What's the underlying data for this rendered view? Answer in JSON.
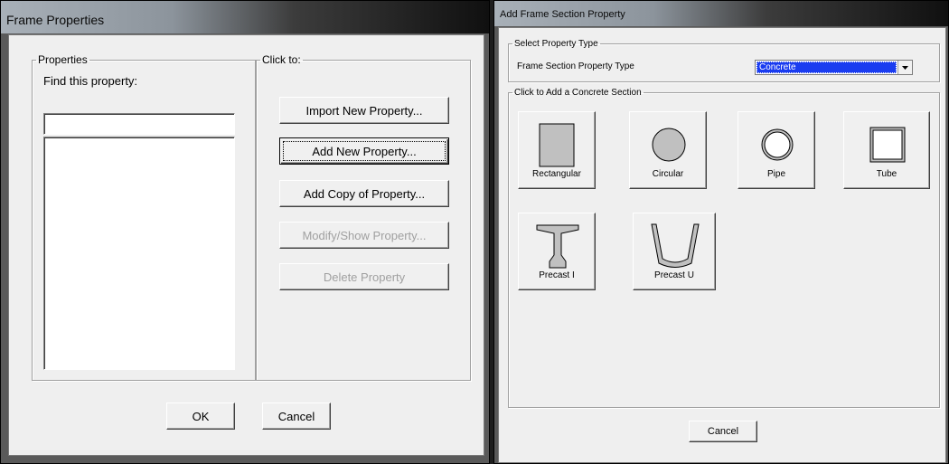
{
  "frame_properties": {
    "title": "Frame Properties",
    "properties_group": "Properties",
    "find_label": "Find this property:",
    "find_value": "",
    "click_group": "Click to:",
    "buttons": {
      "import": "Import New Property...",
      "add_new": "Add New Property...",
      "add_copy": "Add Copy of Property...",
      "modify": "Modify/Show Property...",
      "delete": "Delete Property"
    },
    "ok": "OK",
    "cancel": "Cancel"
  },
  "add_frame_section": {
    "title": "Add Frame Section Property",
    "select_group": "Select Property Type",
    "type_label": "Frame Section Property Type",
    "type_value": "Concrete",
    "sections_group": "Click to Add a Concrete Section",
    "sections": {
      "rectangular": "Rectangular",
      "circular": "Circular",
      "pipe": "Pipe",
      "tube": "Tube",
      "precast_i": "Precast I",
      "precast_u": "Precast U"
    },
    "cancel": "Cancel"
  },
  "colors": {
    "selection_blue": "#1a3cf0",
    "window_face": "#efefef"
  }
}
